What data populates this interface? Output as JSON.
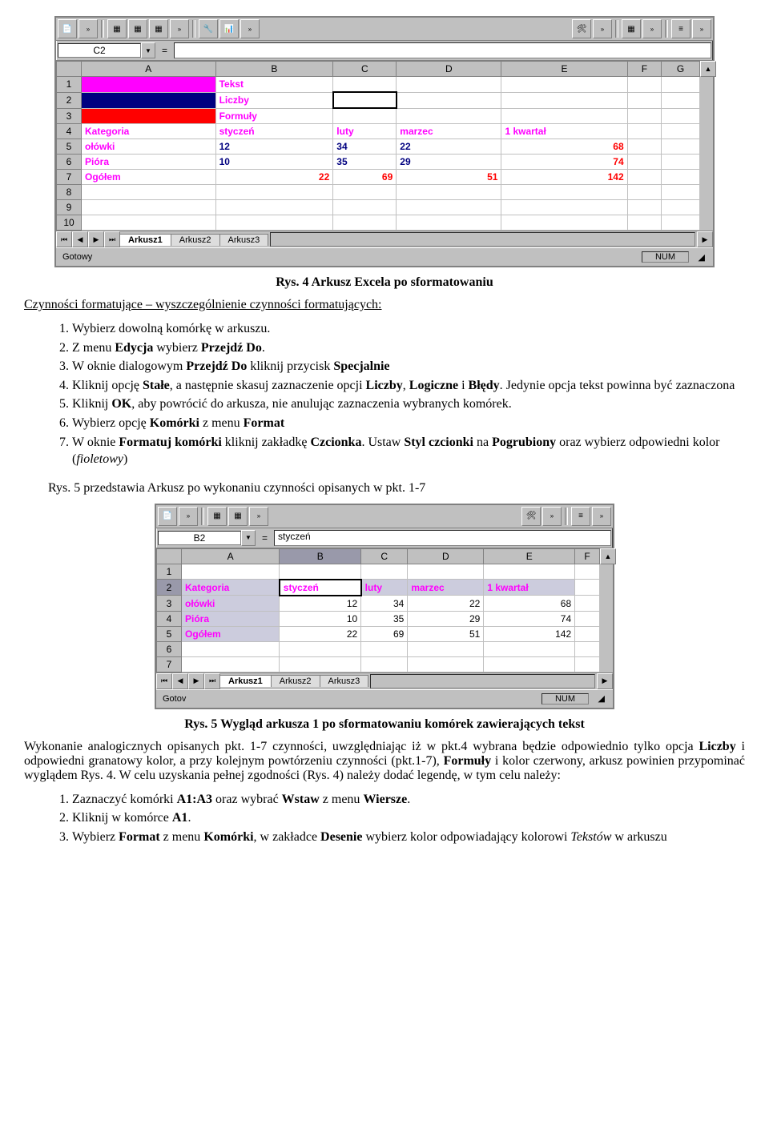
{
  "excel1": {
    "namebox": "C2",
    "cols": [
      "A",
      "B",
      "C",
      "D",
      "E",
      "F",
      "G"
    ],
    "rows": [
      "1",
      "2",
      "3",
      "4",
      "5",
      "6",
      "7",
      "8",
      "9",
      "10"
    ],
    "a1_label": "Tekst",
    "a2_label": "Liczby",
    "a3_label": "Formuły",
    "r4": {
      "A": "Kategoria",
      "B": "styczeń",
      "C": "luty",
      "D": "marzec",
      "E": "1 kwartał"
    },
    "r5": {
      "A": "ołówki",
      "B": "12",
      "C": "34",
      "D": "22",
      "E": "68"
    },
    "r6": {
      "A": "Pióra",
      "B": "10",
      "C": "35",
      "D": "29",
      "E": "74"
    },
    "r7": {
      "A": "Ogółem",
      "B": "22",
      "C": "69",
      "D": "51",
      "E": "142"
    },
    "tabs": [
      "Arkusz1",
      "Arkusz2",
      "Arkusz3"
    ],
    "status": "Gotowy",
    "num": "NUM"
  },
  "caption1": "Rys. 4 Arkusz Excela po sformatowaniu",
  "intro": "Czynności formatujące – wyszczególnienie czynności formatujących:",
  "list1": {
    "i1": "Wybierz dowolną komórkę w arkuszu.",
    "i2a": "Z menu ",
    "i2b": "Edycja",
    "i2c": "  wybierz ",
    "i2d": "Przejdź Do",
    "i2e": ".",
    "i3a": "W oknie dialogowym ",
    "i3b": "Przejdź Do",
    "i3c": " kliknij przycisk ",
    "i3d": "Specjalnie",
    "i4a": "Kliknij opcję ",
    "i4b": "Stałe",
    "i4c": ", a następnie skasuj zaznaczenie opcji ",
    "i4d": "Liczby",
    "i4e": ", ",
    "i4f": "Logiczne",
    "i4g": " i ",
    "i4h": "Błędy",
    "i4i": ". Jedynie opcja tekst powinna być zaznaczona",
    "i5a": "Kliknij ",
    "i5b": "OK",
    "i5c": ", aby powrócić do arkusza, nie anulując zaznaczenia wybranych komórek.",
    "i6a": "Wybierz opcję ",
    "i6b": "Komórki",
    "i6c": " z menu ",
    "i6d": "Format",
    "i7a": "W oknie ",
    "i7b": "Formatuj komórki",
    "i7c": " kliknij zakładkę ",
    "i7d": "Czcionka",
    "i7e": ". Ustaw ",
    "i7f": "Styl czcionki",
    "i7g": " na ",
    "i7h": "Pogrubiony",
    "i7i": " oraz wybierz odpowiedni kolor (",
    "i7j": "fioletowy",
    "i7k": ")"
  },
  "mid": "Rys. 5 przedstawia Arkusz po wykonaniu czynności opisanych w pkt. 1-7",
  "excel2": {
    "namebox": "B2",
    "formula": "styczeń",
    "cols": [
      "A",
      "B",
      "C",
      "D",
      "E",
      "F"
    ],
    "rows": [
      "1",
      "2",
      "3",
      "4",
      "5",
      "6",
      "7"
    ],
    "r2": {
      "A": "Kategoria",
      "B": "styczeń",
      "C": "luty",
      "D": "marzec",
      "E": "1 kwartał"
    },
    "r3": {
      "A": "ołówki",
      "B": "12",
      "C": "34",
      "D": "22",
      "E": "68"
    },
    "r4": {
      "A": "Pióra",
      "B": "10",
      "C": "35",
      "D": "29",
      "E": "74"
    },
    "r5": {
      "A": "Ogółem",
      "B": "22",
      "C": "69",
      "D": "51",
      "E": "142"
    },
    "tabs": [
      "Arkusz1",
      "Arkusz2",
      "Arkusz3"
    ],
    "status": "Gotov",
    "num": "NUM"
  },
  "caption2": "Rys. 5 Wygląd arkusza 1 po sformatowaniu komórek zawierających tekst",
  "para2a": "Wykonanie analogicznych opisanych pkt. 1-7 czynności, uwzględniając iż w pkt.4 wybrana będzie odpowiednio tylko opcja ",
  "para2b": "Liczby",
  "para2c": "  i odpowiedni granatowy kolor, a przy kolejnym powtórzeniu czynności (pkt.1-7), ",
  "para2d": "Formuły",
  "para2e": " i kolor czerwony, arkusz powinien przypominać wyglądem Rys. 4. W celu uzyskania pełnej zgodności (Rys. 4) należy dodać legendę, w tym celu należy:",
  "list2": {
    "i1a": "Zaznaczyć komórki ",
    "i1b": "A1:A3",
    "i1c": " oraz wybrać ",
    "i1d": "Wstaw",
    "i1e": " z menu ",
    "i1f": "Wiersze",
    "i1g": ".",
    "i2a": "Kliknij w komórce ",
    "i2b": "A1",
    "i2c": ".",
    "i3a": "Wybierz ",
    "i3b": "Format",
    "i3c": " z menu ",
    "i3d": "Komórki",
    "i3e": ", w zakładce ",
    "i3f": "Desenie",
    "i3g": " wybierz kolor odpowiadający kolorowi ",
    "i3h": "Tekstów",
    "i3i": " w arkuszu"
  },
  "chart_data": [
    {
      "type": "table",
      "title": "Rys. 4 Arkusz Excela po sformatowaniu",
      "categories": [
        "styczeń",
        "luty",
        "marzec",
        "1 kwartał"
      ],
      "series": [
        {
          "name": "ołówki",
          "values": [
            12,
            34,
            22,
            68
          ]
        },
        {
          "name": "Pióra",
          "values": [
            10,
            35,
            29,
            74
          ]
        },
        {
          "name": "Ogółem",
          "values": [
            22,
            69,
            51,
            142
          ]
        }
      ]
    },
    {
      "type": "table",
      "title": "Rys. 5 Wygląd arkusza 1 po sformatowaniu komórek zawierających tekst",
      "categories": [
        "styczeń",
        "luty",
        "marzec",
        "1 kwartał"
      ],
      "series": [
        {
          "name": "ołówki",
          "values": [
            12,
            34,
            22,
            68
          ]
        },
        {
          "name": "Pióra",
          "values": [
            10,
            35,
            29,
            74
          ]
        },
        {
          "name": "Ogółem",
          "values": [
            22,
            69,
            51,
            142
          ]
        }
      ]
    }
  ]
}
